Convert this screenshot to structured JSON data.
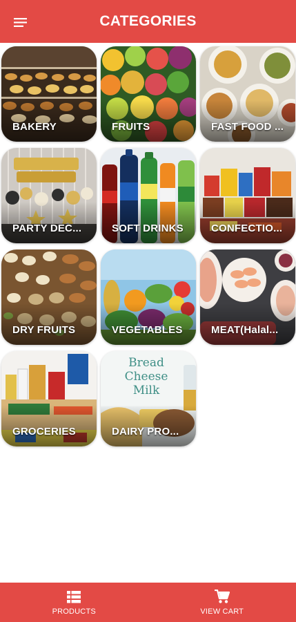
{
  "header": {
    "title": "CATEGORIES",
    "menu_icon": "hamburger-menu-icon"
  },
  "categories": [
    {
      "label": "BAKERY",
      "art": "bakery"
    },
    {
      "label": "FRUITS",
      "art": "fruits"
    },
    {
      "label": "FAST FOOD ...",
      "art": "fastfood"
    },
    {
      "label": "PARTY DEC...",
      "art": "party"
    },
    {
      "label": "SOFT DRINKS",
      "art": "drinks"
    },
    {
      "label": "CONFECTIO...",
      "art": "confectionery"
    },
    {
      "label": "DRY FRUITS",
      "art": "dryfruits"
    },
    {
      "label": "VEGETABLES",
      "art": "vegetables"
    },
    {
      "label": "MEAT(Halal...",
      "art": "meat"
    },
    {
      "label": "GROCERIES",
      "art": "groceries"
    },
    {
      "label": "DAIRY PRO...",
      "art": "dairy",
      "art_text": [
        "Bread",
        "Cheese",
        "Milk"
      ]
    }
  ],
  "bottom_nav": {
    "items": [
      {
        "label": "PRODUCTS",
        "icon": "list-grid-icon"
      },
      {
        "label": "VIEW CART",
        "icon": "shopping-cart-icon"
      }
    ]
  },
  "colors": {
    "brand_red": "#e34a45",
    "label_text": "#ffffff"
  }
}
